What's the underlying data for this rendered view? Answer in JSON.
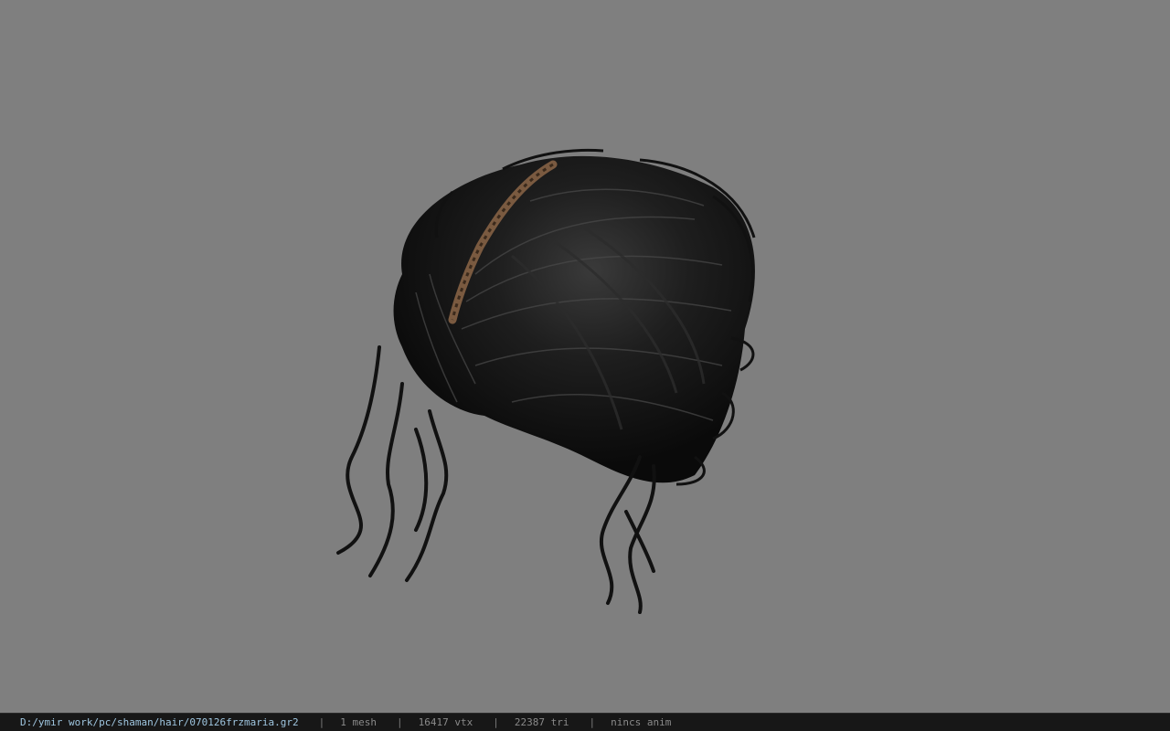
{
  "viewport": {
    "background": "#7f7f7f",
    "model_name": "hair mesh"
  },
  "statusbar": {
    "path": "D:/ymir work/pc/shaman/hair/070126frzmaria.gr2",
    "separator": "|",
    "mesh": "1 mesh",
    "vtx": "16417 vtx",
    "tri": "22387 tri",
    "anim": "nincs anim"
  }
}
